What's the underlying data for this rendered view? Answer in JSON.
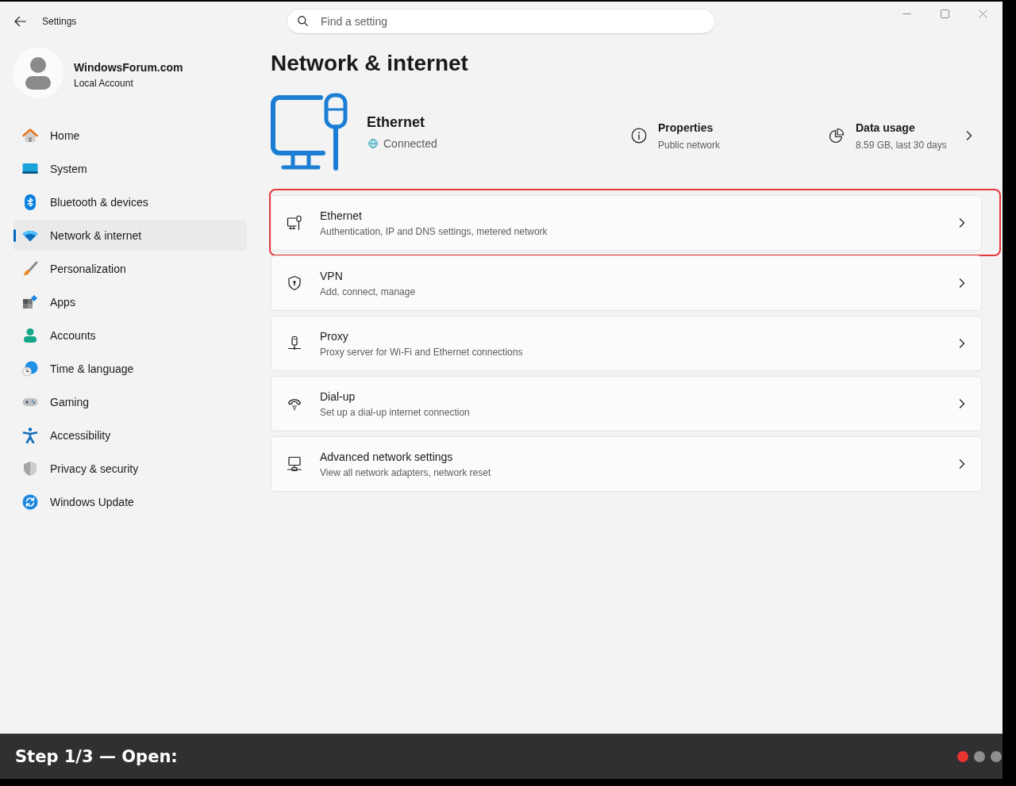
{
  "window": {
    "title": "Settings"
  },
  "search": {
    "placeholder": "Find a setting"
  },
  "account": {
    "name": "WindowsForum.com",
    "type": "Local Account"
  },
  "sidebar": {
    "items": [
      {
        "kind": "home",
        "label": "Home",
        "selected": false
      },
      {
        "kind": "system",
        "label": "System",
        "selected": false
      },
      {
        "kind": "bluetooth",
        "label": "Bluetooth & devices",
        "selected": false
      },
      {
        "kind": "network",
        "label": "Network & internet",
        "selected": true
      },
      {
        "kind": "personalization",
        "label": "Personalization",
        "selected": false
      },
      {
        "kind": "apps",
        "label": "Apps",
        "selected": false
      },
      {
        "kind": "accounts",
        "label": "Accounts",
        "selected": false
      },
      {
        "kind": "time",
        "label": "Time & language",
        "selected": false
      },
      {
        "kind": "gaming",
        "label": "Gaming",
        "selected": false
      },
      {
        "kind": "accessibility",
        "label": "Accessibility",
        "selected": false
      },
      {
        "kind": "privacy",
        "label": "Privacy & security",
        "selected": false
      },
      {
        "kind": "update",
        "label": "Windows Update",
        "selected": false
      }
    ]
  },
  "page": {
    "title": "Network & internet"
  },
  "connection": {
    "name": "Ethernet",
    "status": "Connected",
    "properties": {
      "title": "Properties",
      "value": "Public network"
    },
    "data_usage": {
      "title": "Data usage",
      "value": "8.59 GB, last 30 days"
    }
  },
  "options": [
    {
      "kind": "ethernet",
      "title": "Ethernet",
      "description": "Authentication, IP and DNS settings, metered network",
      "highlighted": true
    },
    {
      "kind": "vpn",
      "title": "VPN",
      "description": "Add, connect, manage",
      "highlighted": false
    },
    {
      "kind": "proxy",
      "title": "Proxy",
      "description": "Proxy server for Wi-Fi and Ethernet connections",
      "highlighted": false
    },
    {
      "kind": "dialup",
      "title": "Dial-up",
      "description": "Set up a dial-up internet connection",
      "highlighted": false
    },
    {
      "kind": "advanced",
      "title": "Advanced network settings",
      "description": "View all network adapters, network reset",
      "highlighted": false
    }
  ],
  "caption": {
    "text": "Step 1/3 — Open:",
    "steps": [
      {
        "selected": true
      },
      {
        "selected": false
      },
      {
        "selected": false
      }
    ]
  }
}
